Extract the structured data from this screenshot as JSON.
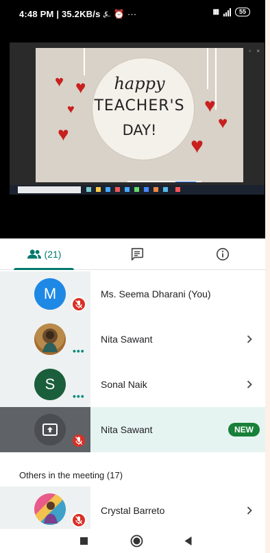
{
  "status_bar": {
    "time": "4:48 PM | 35.2KB/s",
    "battery": "55"
  },
  "shared_screen": {
    "line1": "happy",
    "line2": "TEACHER'S",
    "line3": "DAY!"
  },
  "tabs": {
    "people_count": "(21)"
  },
  "participants": [
    {
      "name": "Ms. Seema Dharani (You)",
      "initial": "M",
      "avatar_color": "#1e88e5"
    },
    {
      "name": "Nita Sawant"
    },
    {
      "name": "Sonal Naik",
      "initial": "S",
      "avatar_color": "#1b5e3b"
    },
    {
      "name": "Nita Sawant",
      "badge": "NEW"
    }
  ],
  "others": {
    "title": "Others in the meeting (17)",
    "items": [
      {
        "name": "Crystal Barreto"
      }
    ]
  },
  "colors": {
    "accent": "#00796b",
    "mute": "#d93025",
    "new_badge": "#188038"
  }
}
